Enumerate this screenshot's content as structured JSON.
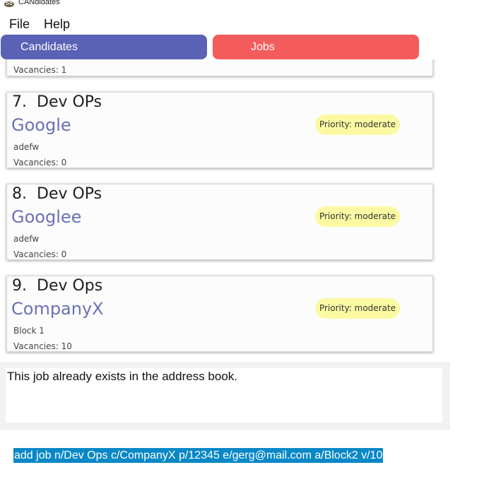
{
  "window": {
    "title": "CANdidates",
    "icon": "app-logo-icon"
  },
  "menu": {
    "items": [
      "File",
      "Help"
    ]
  },
  "tabs": {
    "candidates": "Candidates",
    "jobs": "Jobs"
  },
  "partial_card": {
    "vacancies": "Vacancies: 1"
  },
  "jobs": [
    {
      "index": "7.",
      "title": "Dev OPs",
      "company": "Google",
      "address": "adefw",
      "vacancies": "Vacancies: 0",
      "priority": "Priority: moderate"
    },
    {
      "index": "8.",
      "title": "Dev OPs",
      "company": "Googlee",
      "address": "adefw",
      "vacancies": "Vacancies: 0",
      "priority": "Priority: moderate"
    },
    {
      "index": "9.",
      "title": "Dev Ops",
      "company": "CompanyX",
      "address": "Block 1",
      "vacancies": "Vacancies: 10",
      "priority": "Priority: moderate"
    }
  ],
  "result": {
    "message": "This job already exists in the address book."
  },
  "command": {
    "value": "add job n/Dev Ops c/CompanyX p/12345 e/gerg@mail.com a/Block2 v/10"
  },
  "colors": {
    "candidates_tab": "#5a62b5",
    "jobs_tab": "#f45c5c",
    "priority_badge": "#fbfaa3",
    "company_text": "#6b71b3",
    "command_highlight": "#0a88c6"
  }
}
